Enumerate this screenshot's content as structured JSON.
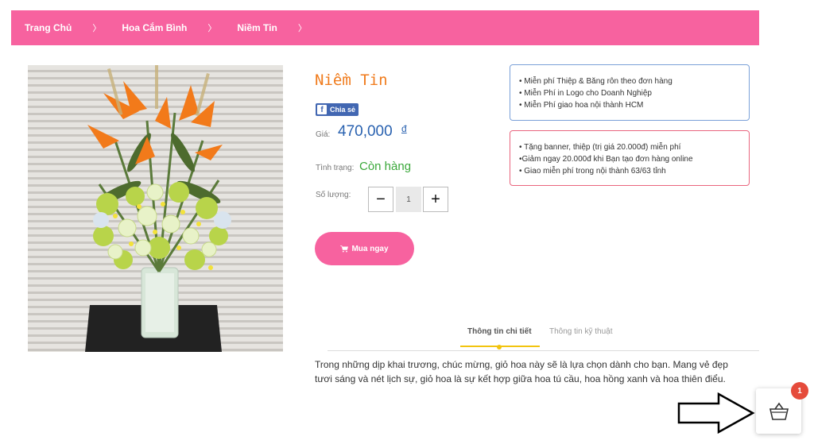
{
  "breadcrumb": {
    "items": [
      "Trang Chủ",
      "Hoa Cắm Bình",
      "Niềm Tin"
    ],
    "separator": "〉"
  },
  "product": {
    "title": "Niềm Tin",
    "share_label": "Chia sẻ",
    "price_label": "Giá:",
    "price": "470,000",
    "currency": "đ",
    "stock_label": "Tình trạng:",
    "stock_value": "Còn hàng",
    "quantity_label": "Số lượng:",
    "quantity": "1",
    "minus_label": "−",
    "plus_label": "+",
    "buy_label": "Mua ngay"
  },
  "promo_box_1": {
    "items": [
      "• Miễn phí Thiệp & Băng rôn theo đơn hàng",
      "• Miễn Phí in Logo cho Doanh Nghiệp",
      "• Miễn Phí giao hoa nội thành HCM"
    ]
  },
  "promo_box_2": {
    "items": [
      "• Tặng banner, thiệp (trị giá 20.000đ) miễn phí",
      "•Giảm ngay 20.000đ khi Bạn tạo đơn hàng online",
      "• Giao miễn phí trong nội thành 63/63 tỉnh"
    ]
  },
  "tabs": {
    "items": [
      "Thông tin chi tiết",
      "Thông tin kỹ thuật"
    ],
    "active": "Thông tin chi tiết"
  },
  "description": "Trong những dịp khai trương, chúc mừng, giỏ hoa này sẽ là lựa chọn dành cho bạn. Mang vẻ đẹp tươi sáng và nét lịch sự, giỏ hoa là sự kết hợp giữa hoa tú cầu, hoa hồng xanh và hoa thiên điểu.",
  "cart": {
    "badge_count": "1"
  },
  "colors": {
    "brand_pink": "#f7629f",
    "title_orange": "#f07b1c",
    "price_blue": "#2a62b0",
    "stock_green": "#3aa83a",
    "tab_accent": "#f2c40f",
    "badge_red": "#e54b3b"
  },
  "icons": [
    "facebook-icon",
    "cart-icon",
    "basket-icon",
    "arrow-right-icon"
  ]
}
